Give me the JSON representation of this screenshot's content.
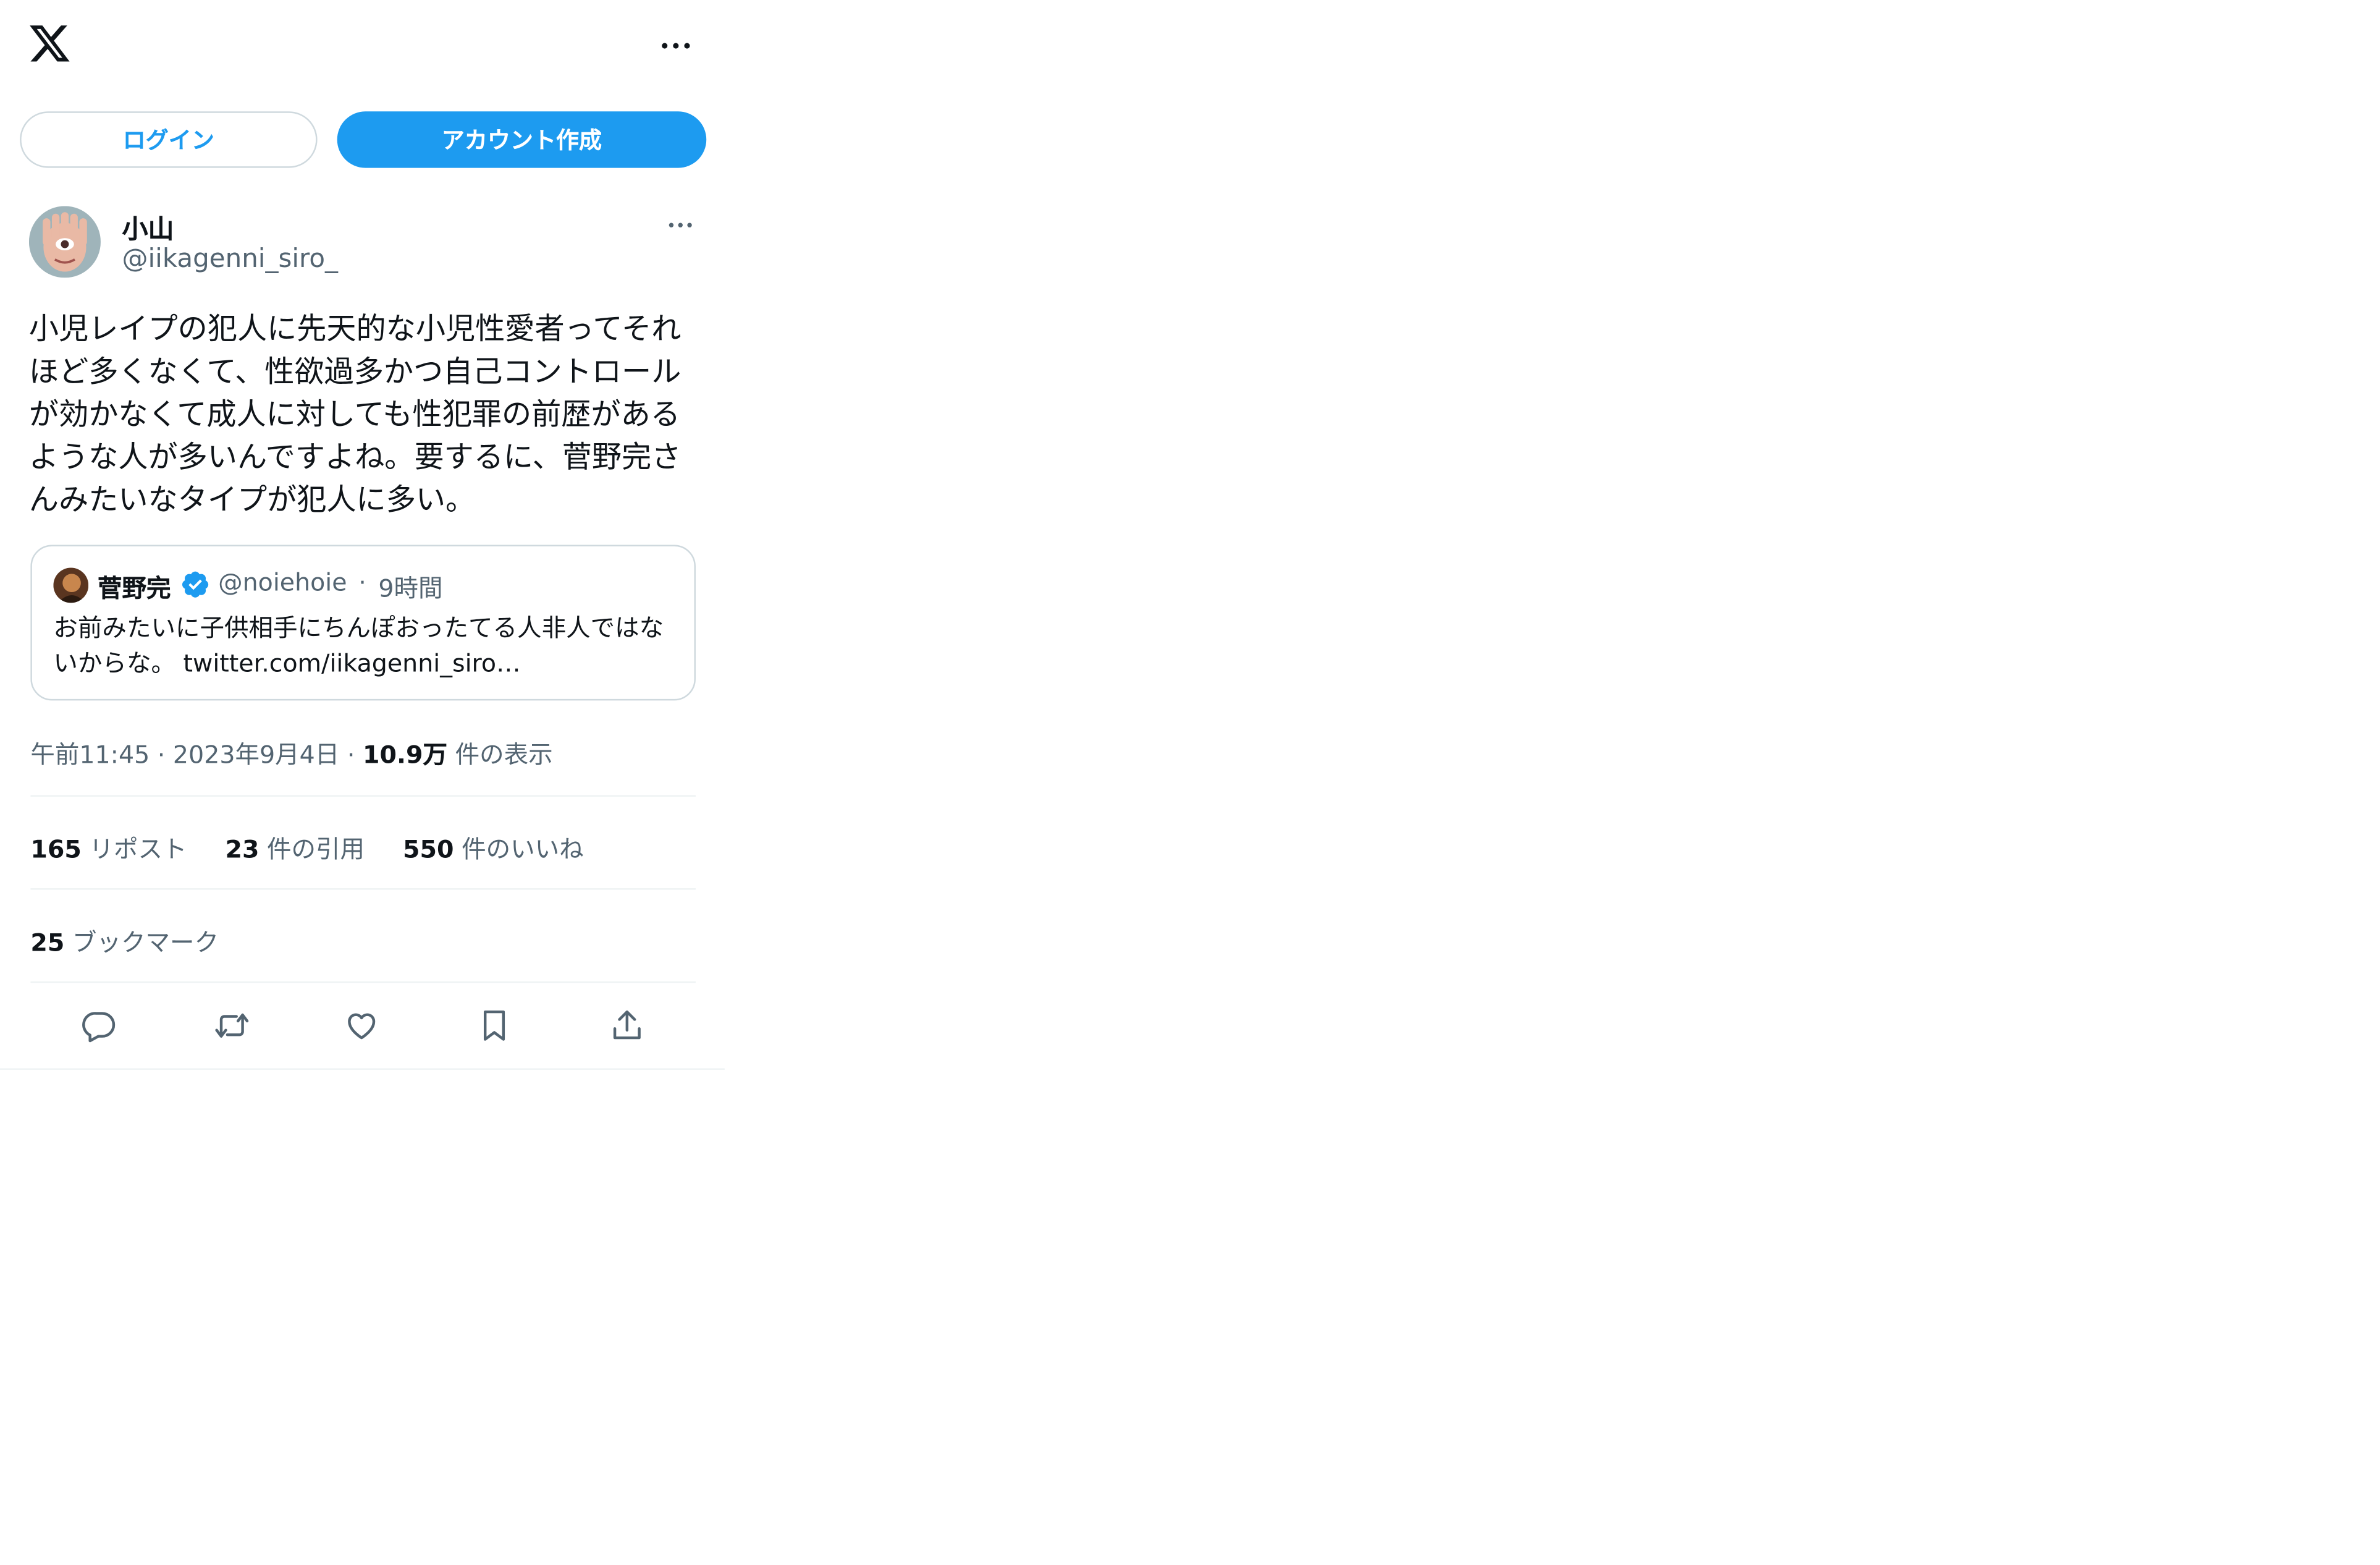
{
  "header": {
    "logo_icon": "x-logo-icon",
    "more_icon": "more-icon"
  },
  "auth": {
    "login_label": "ログイン",
    "signup_label": "アカウント作成"
  },
  "tweet": {
    "author_name": "小山",
    "author_handle": "@iikagenni_siro_",
    "text": "小児レイプの犯人に先天的な小児性愛者ってそれほど多くなくて、性欲過多かつ自己コントロールが効かなくて成人に対しても性犯罪の前歴があるような人が多いんですよね。要するに、菅野完さんみたいなタイプが犯人に多い。",
    "quote": {
      "author_name": "菅野完",
      "author_handle": "@noiehoie",
      "separator": "·",
      "time": "9時間",
      "text": "お前みたいに子供相手にちんぽおったてる人非人ではないからな。 twitter.com/iikagenni_siro…"
    },
    "timestamp": "午前11:45 · 2023年9月4日",
    "separator": "·",
    "views_count": "10.9万",
    "views_label": "件の表示",
    "reposts_count": "165",
    "reposts_label": "リポスト",
    "quotes_count": "23",
    "quotes_label": "件の引用",
    "likes_count": "550",
    "likes_label": "件のいいね",
    "bookmarks_count": "25",
    "bookmarks_label": "ブックマーク"
  },
  "actions": [
    "reply-icon",
    "retweet-icon",
    "like-icon",
    "bookmark-icon",
    "share-icon"
  ],
  "colors": {
    "accent": "#1d9bf0",
    "text": "#0f1419",
    "secondary": "#536471",
    "border": "#cfd9de",
    "divider": "#eff3f4"
  }
}
